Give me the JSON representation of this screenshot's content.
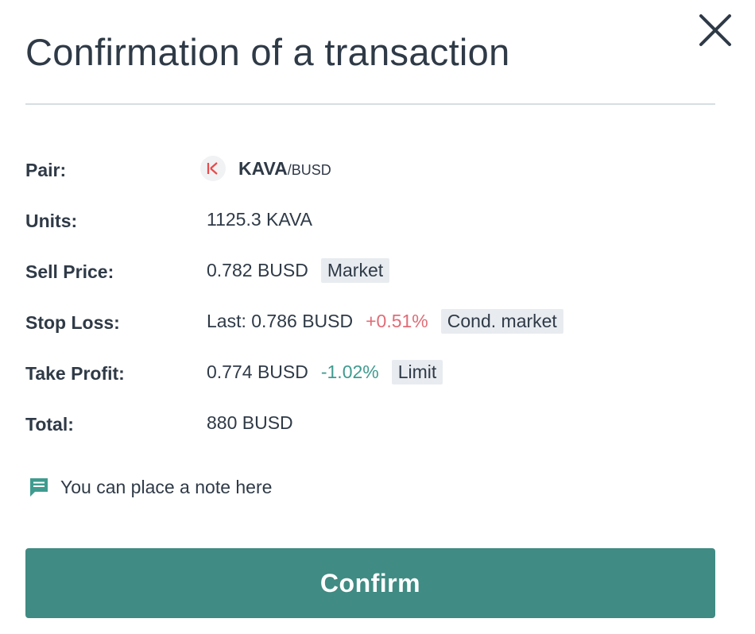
{
  "dialog": {
    "title": "Confirmation of a transaction",
    "close_icon": "close-icon"
  },
  "rows": {
    "pair": {
      "label": "Pair:",
      "coin_icon": "kava-coin-icon",
      "coin_icon_color": "#e84a4a",
      "base": "KAVA",
      "quote": "/BUSD"
    },
    "units": {
      "label": "Units:",
      "value": "1125.3 KAVA"
    },
    "sell_price": {
      "label": "Sell Price:",
      "value": "0.782 BUSD",
      "badge": "Market"
    },
    "stop_loss": {
      "label": "Stop Loss:",
      "value": "Last: 0.786 BUSD",
      "change": "+0.51%",
      "change_color": "#e06c77",
      "badge": "Cond. market"
    },
    "take_profit": {
      "label": "Take Profit:",
      "value": "0.774 BUSD",
      "change": "-1.02%",
      "change_color": "#3f9b8f",
      "badge": "Limit"
    },
    "total": {
      "label": "Total:",
      "value": "880 BUSD"
    }
  },
  "note": {
    "icon": "comment-icon",
    "icon_color": "#3f9b8f",
    "text": "You can place a note here"
  },
  "confirm": {
    "label": "Confirm",
    "color": "#408b83"
  }
}
